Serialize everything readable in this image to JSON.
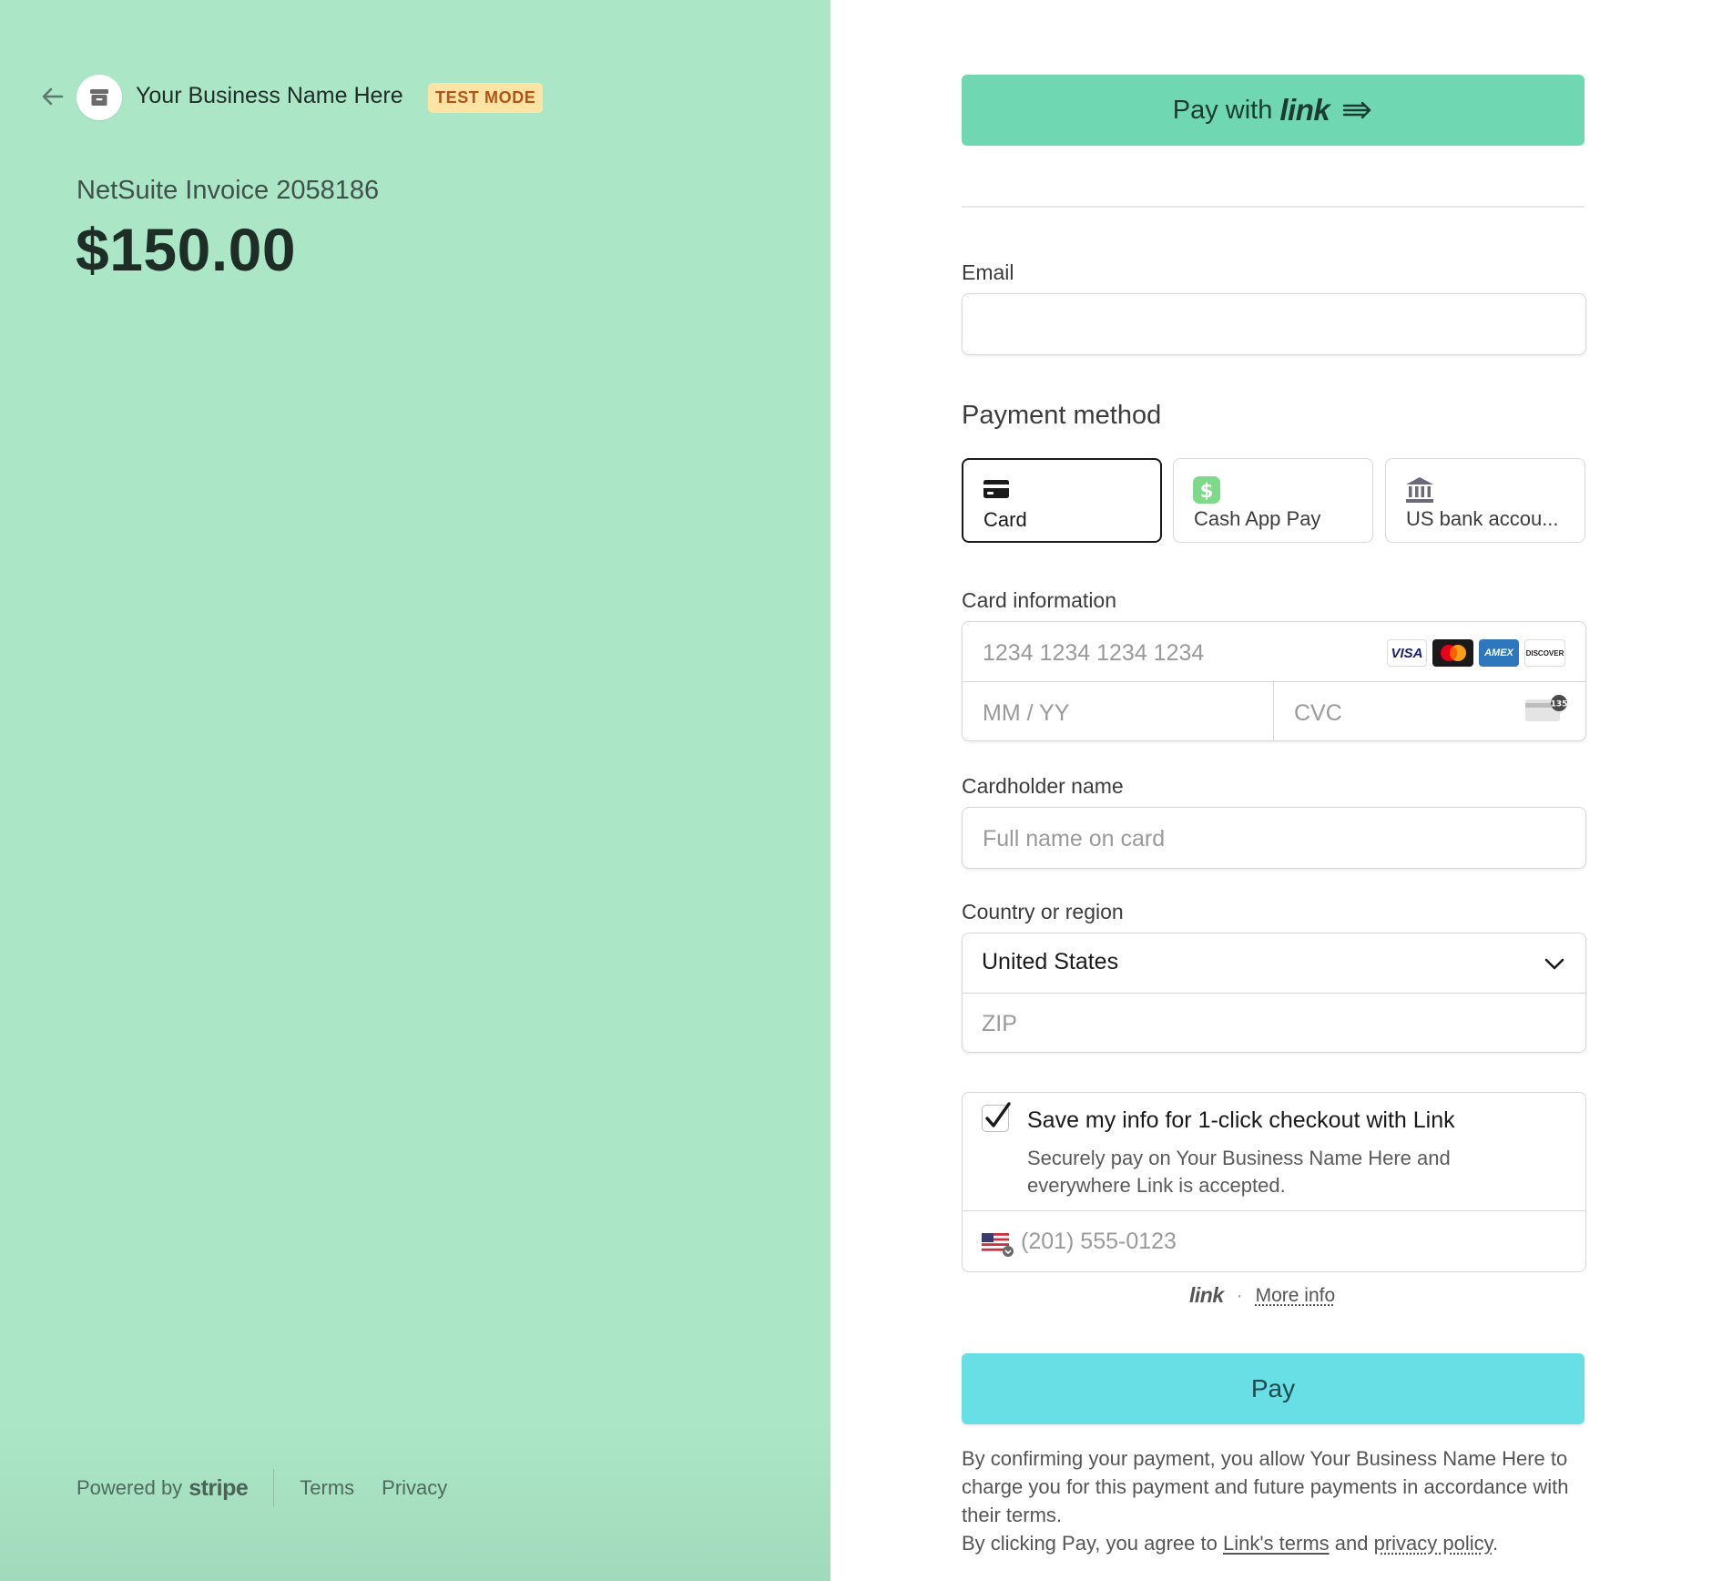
{
  "merchant": {
    "name": "Your Business Name Here",
    "badge": "TEST MODE"
  },
  "invoice": {
    "title": "NetSuite Invoice 2058186",
    "amount": "$150.00"
  },
  "footer": {
    "powered_by": "Powered by",
    "brand": "stripe",
    "terms": "Terms",
    "privacy": "Privacy"
  },
  "link_button": {
    "prefix": "Pay with",
    "brand": "link"
  },
  "email": {
    "label": "Email",
    "value": ""
  },
  "payment_method": {
    "title": "Payment method",
    "tabs": [
      {
        "label": "Card",
        "icon": "card-icon",
        "selected": true
      },
      {
        "label": "Cash App Pay",
        "icon": "cash-app-icon",
        "selected": false
      },
      {
        "label": "US bank accou...",
        "icon": "bank-icon",
        "selected": false
      }
    ]
  },
  "card": {
    "label": "Card information",
    "number_placeholder": "1234 1234 1234 1234",
    "expiry_placeholder": "MM / YY",
    "cvc_placeholder": "CVC",
    "cvc_icon_text": "135",
    "brands": [
      "VISA",
      "mastercard",
      "AMEX",
      "DISCOVER"
    ]
  },
  "cardholder": {
    "label": "Cardholder name",
    "placeholder": "Full name on card"
  },
  "country": {
    "label": "Country or region",
    "selected": "United States",
    "zip_placeholder": "ZIP"
  },
  "save_info": {
    "checked": true,
    "title": "Save my info for 1-click checkout with Link",
    "description": "Securely pay on Your Business Name Here and everywhere Link is accepted.",
    "phone_placeholder": "(201) 555-0123"
  },
  "link_footer": {
    "brand": "link",
    "more_info": "More info"
  },
  "pay_button": "Pay",
  "legal": {
    "line1": "By confirming your payment, you allow Your Business Name Here to charge you for this payment and future payments in accordance with their terms.",
    "line2_prefix": "By clicking Pay, you agree to",
    "link_terms": "Link's terms",
    "and": "and",
    "privacy_policy": "privacy policy",
    "suffix": "."
  },
  "colors": {
    "left_panel": "#abe7c7",
    "link_button": "#6fd8b2",
    "pay_button": "#68dfe4",
    "badge_bg": "#fde4a5",
    "badge_text": "#b0541a"
  }
}
